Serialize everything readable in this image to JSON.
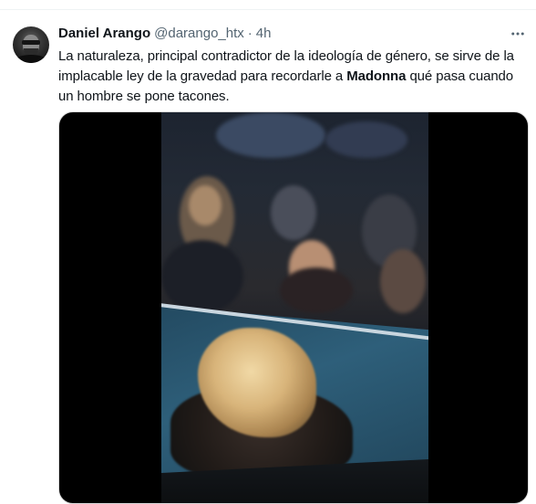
{
  "tweet": {
    "author": {
      "display_name": "Daniel Arango",
      "handle": "@darango_htx",
      "separator": "·",
      "time": "4h"
    },
    "text": {
      "line1": "La naturaleza, principal contradictor de la ideología de género, se sirve de la",
      "line2_before": "implacable ley de la gravedad para recordarle a ",
      "line2_bold": "Madonna",
      "line2_after": " qué pasa cuando",
      "line3": "un hombre se pone tacones."
    },
    "more_icon": "more-horizontal-icon",
    "media": {
      "type": "video"
    }
  },
  "colors": {
    "primary_text": "#0f1419",
    "secondary_text": "#536471",
    "divider": "#eff3f4",
    "media_background": "#000000"
  }
}
